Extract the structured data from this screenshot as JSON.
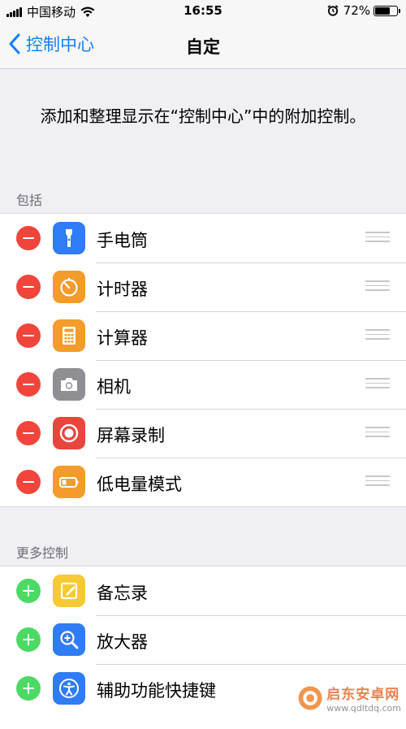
{
  "status_bar": {
    "carrier": "中国移动",
    "time": "16:55",
    "battery_percent_text": "72%",
    "battery_level": 0.72
  },
  "nav": {
    "back_label": "控制中心",
    "title": "自定"
  },
  "intro_text": "添加和整理显示在“控制中心”中的附加控制。",
  "included": {
    "header": "包括",
    "items": [
      {
        "label": "手电筒",
        "icon": "flashlight-icon",
        "color": "#2f7cf6"
      },
      {
        "label": "计时器",
        "icon": "timer-icon",
        "color": "#f39c2b"
      },
      {
        "label": "计算器",
        "icon": "calculator-icon",
        "color": "#f39c2b"
      },
      {
        "label": "相机",
        "icon": "camera-icon",
        "color": "#8e8e93"
      },
      {
        "label": "屏幕录制",
        "icon": "screen-record-icon",
        "color": "#e8453c"
      },
      {
        "label": "低电量模式",
        "icon": "low-power-icon",
        "color": "#f39c2b"
      }
    ]
  },
  "more": {
    "header": "更多控制",
    "items": [
      {
        "label": "备忘录",
        "icon": "notes-icon",
        "color": "#f7c934"
      },
      {
        "label": "放大器",
        "icon": "magnifier-icon",
        "color": "#2f7cf6"
      },
      {
        "label": "辅助功能快捷键",
        "icon": "accessibility-icon",
        "color": "#2f7cf6"
      }
    ]
  },
  "colors": {
    "accent": "#147efb",
    "remove": "#f1453b",
    "add": "#4cd964"
  },
  "watermark": {
    "brand": "启东安卓网",
    "url": "www.qdltdq.com"
  }
}
